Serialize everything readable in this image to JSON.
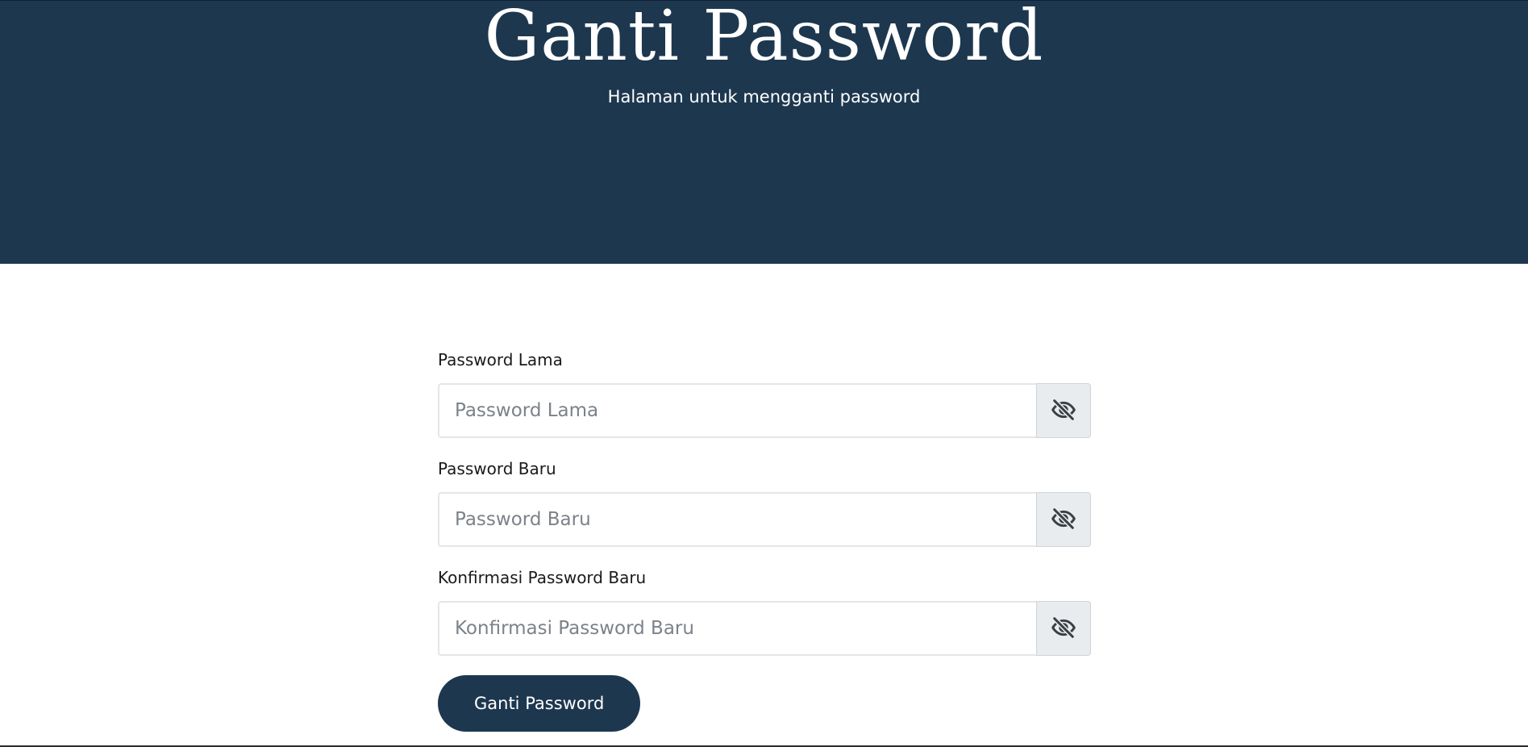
{
  "hero": {
    "title": "Ganti Password",
    "subtitle": "Halaman untuk mengganti password",
    "background_color": "#1d374f"
  },
  "form": {
    "fields": [
      {
        "label": "Password Lama",
        "placeholder": "Password Lama",
        "value": "",
        "toggle_icon": "eye-slash-icon"
      },
      {
        "label": "Password Baru",
        "placeholder": "Password Baru",
        "value": "",
        "toggle_icon": "eye-slash-icon"
      },
      {
        "label": "Konfirmasi Password Baru",
        "placeholder": "Konfirmasi Password Baru",
        "value": "",
        "toggle_icon": "eye-slash-icon"
      }
    ],
    "submit_label": "Ganti Password"
  }
}
